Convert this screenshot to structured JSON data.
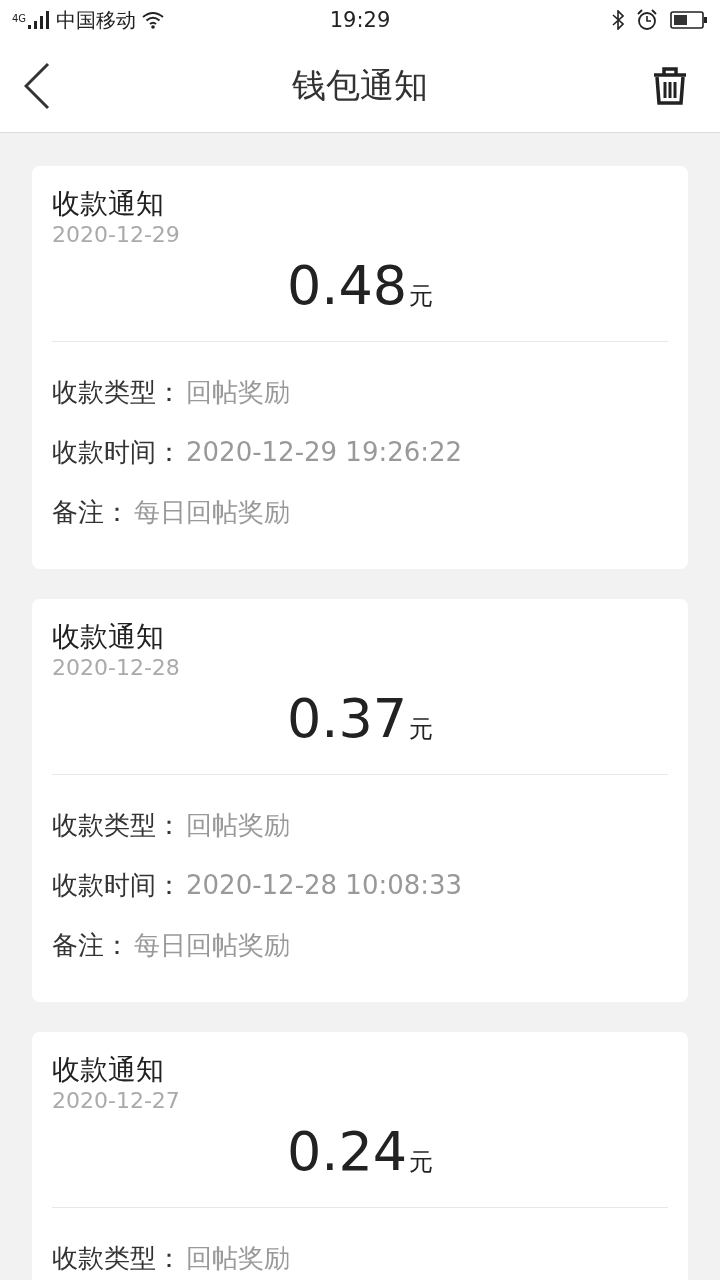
{
  "status_bar": {
    "network": "4G",
    "carrier": "中国移动",
    "time": "19:29"
  },
  "header": {
    "title": "钱包通知"
  },
  "notifications": [
    {
      "title": "收款通知",
      "date": "2020-12-29",
      "amount": "0.48",
      "unit": "元",
      "fields": [
        {
          "label": "收款类型：",
          "value": "回帖奖励"
        },
        {
          "label": "收款时间：",
          "value": "2020-12-29 19:26:22"
        },
        {
          "label": "备注：",
          "value": "每日回帖奖励"
        }
      ]
    },
    {
      "title": "收款通知",
      "date": "2020-12-28",
      "amount": "0.37",
      "unit": "元",
      "fields": [
        {
          "label": "收款类型：",
          "value": "回帖奖励"
        },
        {
          "label": "收款时间：",
          "value": "2020-12-28 10:08:33"
        },
        {
          "label": "备注：",
          "value": "每日回帖奖励"
        }
      ]
    },
    {
      "title": "收款通知",
      "date": "2020-12-27",
      "amount": "0.24",
      "unit": "元",
      "fields": [
        {
          "label": "收款类型：",
          "value": "回帖奖励"
        }
      ]
    }
  ]
}
